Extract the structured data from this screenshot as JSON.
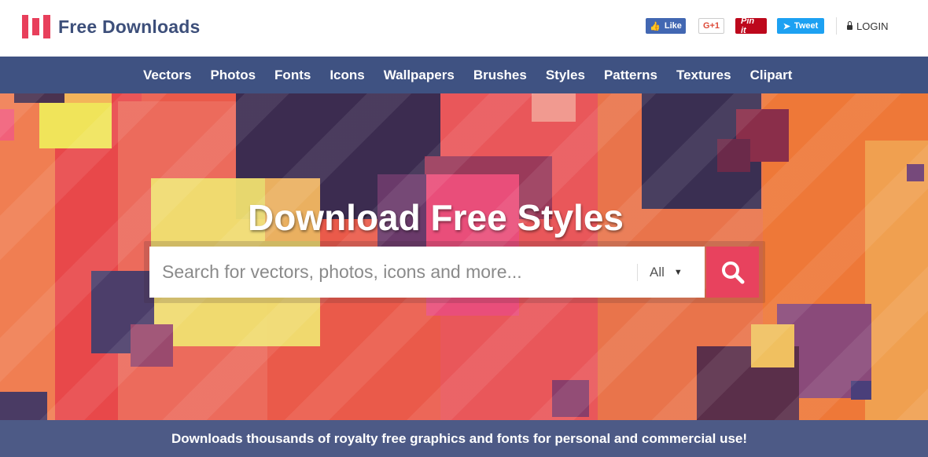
{
  "brand": {
    "name": "Free Downloads"
  },
  "social": {
    "facebook": "Like",
    "google": "G+1",
    "pinterest": "Pin it",
    "twitter": "Tweet"
  },
  "login": "LOGIN",
  "nav": [
    "Vectors",
    "Photos",
    "Fonts",
    "Icons",
    "Wallpapers",
    "Brushes",
    "Styles",
    "Patterns",
    "Textures",
    "Clipart"
  ],
  "hero": {
    "title": "Download Free Styles",
    "search_placeholder": "Search for vectors, photos, icons and more...",
    "filter_value": "All"
  },
  "tagline": "Downloads thousands of royalty free graphics and fonts for personal and commercial use!",
  "colors": {
    "accent": "#e8425e",
    "nav": "#3f5282",
    "brand": "#3d4f7a"
  }
}
